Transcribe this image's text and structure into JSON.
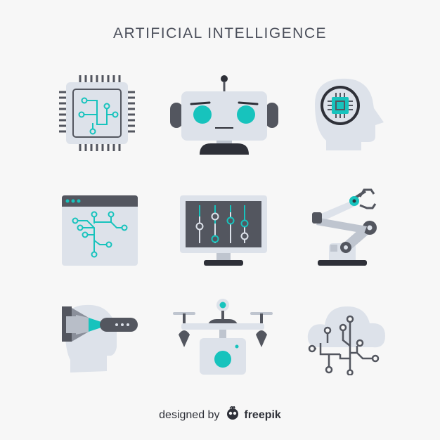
{
  "header": {
    "title": "ARTIFICIAL INTELLIGENCE"
  },
  "icons": [
    {
      "name": "processor-chip-icon"
    },
    {
      "name": "robot-head-icon"
    },
    {
      "name": "human-head-chip-icon"
    },
    {
      "name": "browser-circuit-icon"
    },
    {
      "name": "monitor-sliders-icon"
    },
    {
      "name": "robotic-arm-icon"
    },
    {
      "name": "vr-headset-icon"
    },
    {
      "name": "camera-drone-icon"
    },
    {
      "name": "cloud-network-icon"
    }
  ],
  "footer": {
    "text": "designed by",
    "brand": "freepik"
  },
  "colors": {
    "background": "#f7f7f7",
    "light_gray": "#dde2ea",
    "dark_gray": "#53565f",
    "teal": "#17c3bd",
    "title": "#4b4f5b"
  }
}
